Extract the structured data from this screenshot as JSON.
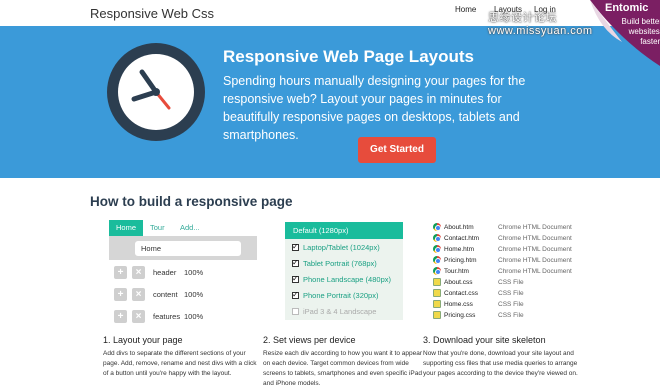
{
  "header": {
    "brand": "Responsive Web Css",
    "nav": {
      "home": "Home",
      "layouts": "Layouts",
      "login": "Log in"
    },
    "watermark": "思缘设计论坛 www.missyuan.com"
  },
  "ribbon": {
    "brand": "Entomic",
    "tagline": "Build better websites, faster."
  },
  "hero": {
    "title": "Responsive Web Page Layouts",
    "text": "Spending hours manually designing your pages for the responsive web? Layout your pages in minutes for beautifully responsive pages on desktops, tablets and smartphones.",
    "cta": "Get Started",
    "icon": "clock-icon"
  },
  "section": {
    "title": "How to build a responsive page"
  },
  "layout_panel": {
    "tabs": [
      "Home",
      "Tour",
      "Add..."
    ],
    "field_value": "Home",
    "rows": [
      {
        "name": "header",
        "pct": "100%"
      },
      {
        "name": "content",
        "pct": "100%"
      },
      {
        "name": "features",
        "pct": "100%"
      }
    ]
  },
  "views_panel": {
    "header": "Default (1280px)",
    "options": [
      {
        "label": "Laptop/Tablet (1024px)",
        "checked": true
      },
      {
        "label": "Tablet Portrait (768px)",
        "checked": true
      },
      {
        "label": "Phone Landscape (480px)",
        "checked": true
      },
      {
        "label": "Phone Portrait (320px)",
        "checked": true
      },
      {
        "label": "iPad 3 & 4 Landscape",
        "checked": false
      }
    ]
  },
  "files": [
    {
      "name": "About.htm",
      "type": "Chrome HTML Document",
      "icon": "chrome"
    },
    {
      "name": "Contact.htm",
      "type": "Chrome HTML Document",
      "icon": "chrome"
    },
    {
      "name": "Home.htm",
      "type": "Chrome HTML Document",
      "icon": "chrome"
    },
    {
      "name": "Pricing.htm",
      "type": "Chrome HTML Document",
      "icon": "chrome"
    },
    {
      "name": "Tour.htm",
      "type": "Chrome HTML Document",
      "icon": "chrome"
    },
    {
      "name": "About.css",
      "type": "CSS File",
      "icon": "css"
    },
    {
      "name": "Contact.css",
      "type": "CSS File",
      "icon": "css"
    },
    {
      "name": "Home.css",
      "type": "CSS File",
      "icon": "css"
    },
    {
      "name": "Pricing.css",
      "type": "CSS File",
      "icon": "css"
    }
  ],
  "steps": [
    {
      "title": "1. Layout your page",
      "text": "Add divs to separate the different sections of your page. Add, remove, rename and nest divs with a click of a button until you're happy with the layout."
    },
    {
      "title": "2. Set views per device",
      "text": "Resize each div according to how you want it to appear on each device. Target common devices from wide screens to tablets, smartphones and even specific iPad and iPhone models."
    },
    {
      "title": "3. Download your site skeleton",
      "text": "Now that you're done, download your site layout and supporting css files that use media queries to arrange your pages according to the device they're viewed on."
    }
  ],
  "colors": {
    "hero_bg": "#3b9ad9",
    "cta": "#e74c3c",
    "accent": "#1abc9c",
    "ribbon": "#7b1f63"
  }
}
